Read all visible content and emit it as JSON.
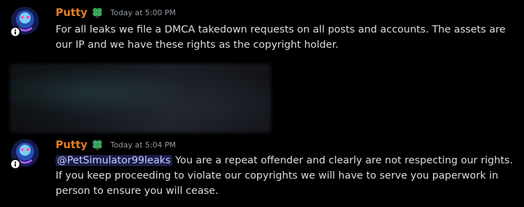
{
  "messages": [
    {
      "author": "Putty",
      "timestamp": "Today at 5:00 PM",
      "text": "For all leaks we file a DMCA takedown requests on all posts and accounts. The assets are our IP and we have these rights as the copyright holder.",
      "attachment": "blurred-image"
    },
    {
      "author": "Putty",
      "timestamp": "Today at 5:04 PM",
      "mention": "@PetSimulator99leaks",
      "text": " You are a repeat offender and clearly are not respecting our rights. If you keep proceeding to violate our copyrights we will have to serve you paperwork in person to ensure you will cease."
    }
  ],
  "colors": {
    "background": "#000000",
    "username": "#e67e22",
    "timestamp": "#949ba4",
    "text": "#dbdee1",
    "mention_bg": "#3b3f8c",
    "role_icon": "#3ba55d"
  },
  "icons": {
    "role": "green-clover-icon",
    "badge": "info-badge-icon"
  }
}
